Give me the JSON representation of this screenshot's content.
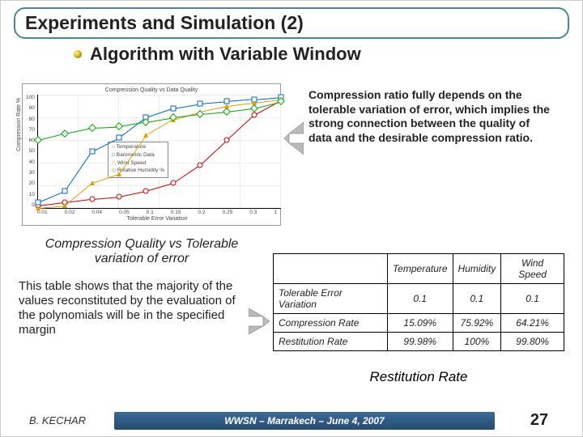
{
  "title": "Experiments and Simulation (2)",
  "subtitle": "Algorithm with Variable Window",
  "chart_data": {
    "type": "line",
    "title": "Compression Quality vs Data Quality",
    "xlabel": "Tolerable Error Variation",
    "ylabel": "Compression Rate %",
    "xticks": [
      "0.01",
      "0.02",
      "0.04",
      "0.05",
      "0.1",
      "0.15",
      "0.2",
      "0.25",
      "0.3",
      "1"
    ],
    "yticks": [
      "0",
      "10",
      "20",
      "30",
      "40",
      "50",
      "60",
      "70",
      "80",
      "90",
      "100"
    ],
    "ylim": [
      0,
      100
    ],
    "series": [
      {
        "name": "Temperature",
        "marker": "circle",
        "color": "#c00",
        "values": [
          2,
          5,
          8,
          10,
          15,
          22,
          38,
          60,
          82,
          95
        ]
      },
      {
        "name": "Barometric Data",
        "marker": "square",
        "color": "#06c",
        "values": [
          5,
          15,
          50,
          62,
          80,
          88,
          92,
          94,
          96,
          98
        ]
      },
      {
        "name": "Wind Speed",
        "marker": "triangle",
        "color": "#e0a000",
        "values": [
          0,
          2,
          22,
          30,
          64,
          78,
          85,
          90,
          93,
          96
        ]
      },
      {
        "name": "Relative Humidity %",
        "marker": "diamond",
        "color": "#0a0",
        "values": [
          60,
          66,
          71,
          72,
          76,
          80,
          83,
          85,
          88,
          94
        ]
      }
    ]
  },
  "right_text": "Compression ratio fully depends on the tolerable variation of error, which implies the strong connection between the quality of data and the desirable compression ratio.",
  "chart_caption": "Compression Quality vs Tolerable variation of error",
  "table_desc": "This table shows that the majority of the values reconstituted by the evaluation of the polynomials will be in the specified margin",
  "table": {
    "columns": [
      "",
      "Temperature",
      "Humidity",
      "Wind Speed"
    ],
    "rows": [
      {
        "label": "Tolerable Error Variation",
        "values": [
          "0.1",
          "0.1",
          "0.1"
        ]
      },
      {
        "label": "Compression Rate",
        "values": [
          "15.09%",
          "75.92%",
          "64.21%"
        ]
      },
      {
        "label": "Restitution Rate",
        "values": [
          "99.98%",
          "100%",
          "99.80%"
        ]
      }
    ]
  },
  "restitution_title": "Restitution Rate",
  "footer": {
    "author": "B. KECHAR",
    "event": "WWSN – Marrakech – June 4, 2007",
    "page": "27"
  }
}
